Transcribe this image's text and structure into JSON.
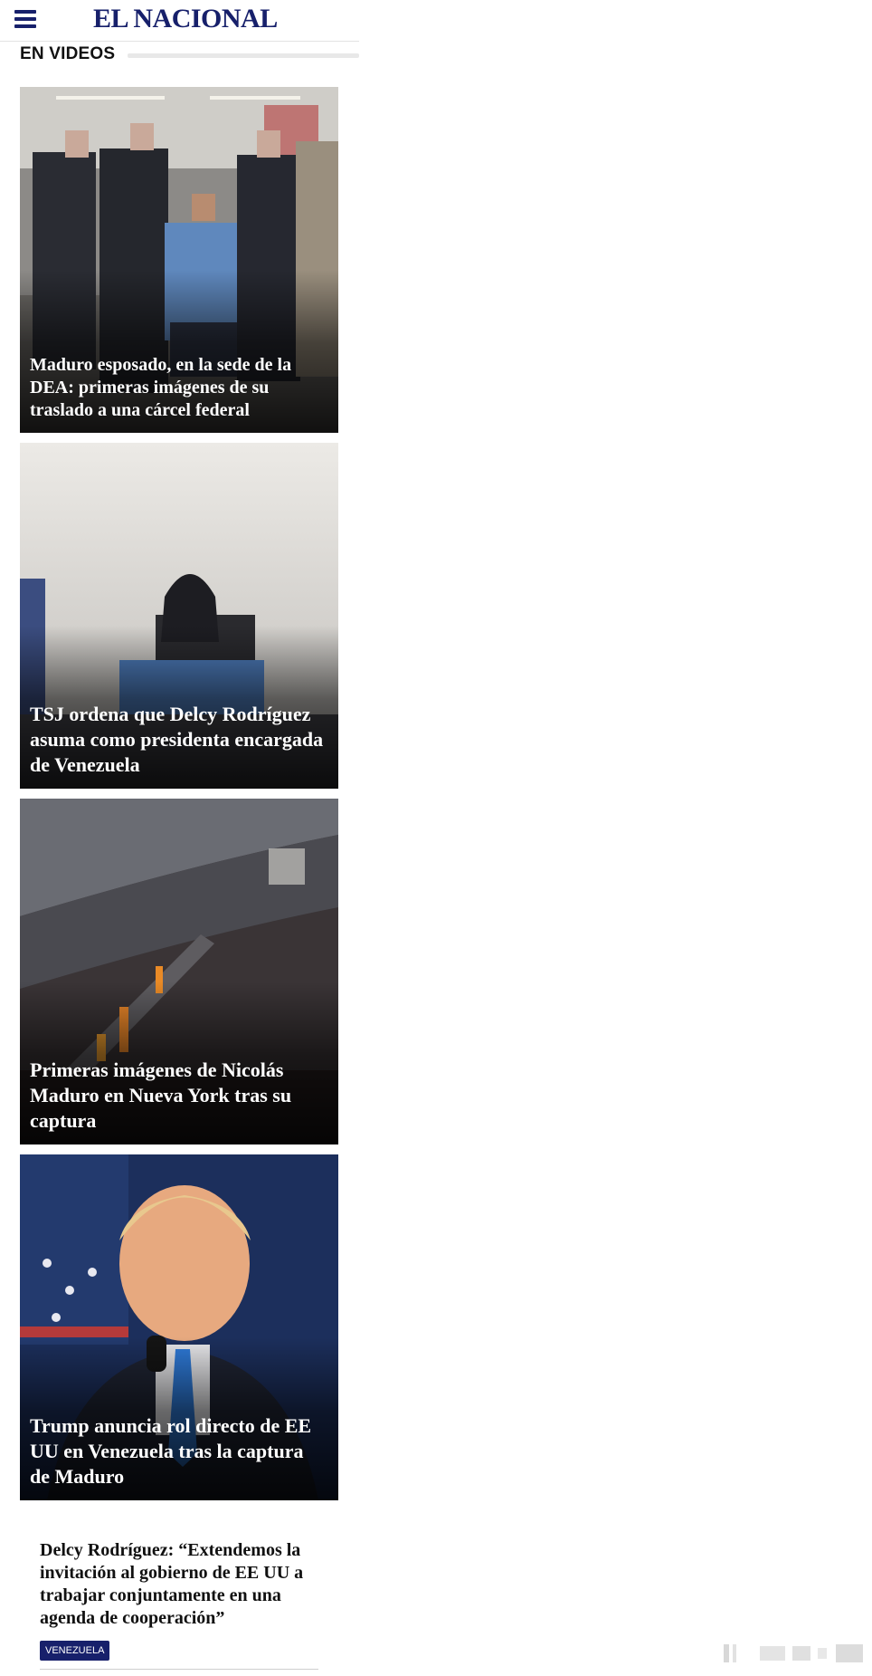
{
  "header": {
    "brand": "EL NACIONAL",
    "menu_icon": "hamburger-menu-icon"
  },
  "section": {
    "title": "EN VIDEOS"
  },
  "video_cards": [
    {
      "headline": "Maduro esposado, en la sede de la DEA: primeras imágenes de su traslado a una cárcel federal"
    },
    {
      "headline": "TSJ ordena que Delcy Rodríguez asuma como presidenta encargada de Venezuela"
    },
    {
      "headline": "Primeras imágenes de Nicolás Maduro en Nueva York tras su captura"
    },
    {
      "headline": "Trump anuncia rol directo de EE UU en Venezuela tras la captura de Maduro"
    }
  ],
  "article": {
    "title": "Delcy Rodríguez: “Extendemos la invitación al gobierno de EE UU a trabajar conjuntamente en una agenda de cooperación”",
    "category": "VENEZUELA"
  },
  "colors": {
    "brand": "#17206b",
    "overlay": "#000000"
  }
}
